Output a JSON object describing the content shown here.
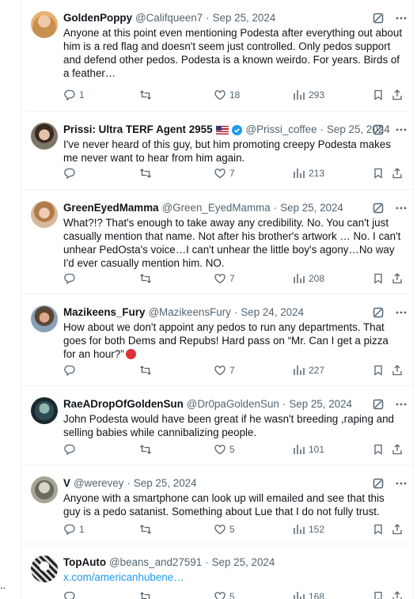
{
  "edge_text": "..",
  "tweets": [
    {
      "display_name": "GoldenPoppy",
      "handle": "@Califqueen7",
      "sep": "·",
      "date": "Sep 25, 2024",
      "flag": false,
      "verified": false,
      "text": "Anyone at this point even mentioning Podesta after everything out about him is a red flag and doesn't seem just controlled. Only pedos support and defend other pedos. Podesta is a known weirdo. For years. Birds of a feather…",
      "replies": "1",
      "retweets": "",
      "likes": "18",
      "views": "293"
    },
    {
      "display_name": "Prissi: Ultra TERF Agent 2955",
      "handle": "@Prissi_coffee",
      "sep": "·",
      "date": "Sep 25, 2024",
      "flag": true,
      "verified": true,
      "text": "I've never heard of this guy, but him promoting creepy Podesta makes me never want to hear from him again.",
      "replies": "",
      "retweets": "",
      "likes": "7",
      "views": "213"
    },
    {
      "display_name": "GreenEyedMamma",
      "handle": "@Green_EyedMamma",
      "sep": "·",
      "date": "Sep 25, 2024",
      "flag": false,
      "verified": false,
      "text": "What?!? That's enough to take away any credibility. No. You can't just casually mention that name. Not after his brother's artwork … No. I can't unhear PedOsta's voice…I can't unhear the little boy's agony…No way I'd ever casually mention him. NO.",
      "replies": "",
      "retweets": "",
      "likes": "7",
      "views": "208"
    },
    {
      "display_name": "Mazikeens_Fury",
      "handle": "@MazikeensFury",
      "sep": "·",
      "date": "Sep 24, 2024",
      "flag": false,
      "verified": false,
      "text": "How about we don't appoint any pedos to run any departments. That goes for both Dems and Repubs!  Hard pass on “Mr. Can I get a pizza for an hour?”",
      "emoji": "angry-face",
      "replies": "",
      "retweets": "",
      "likes": "7",
      "views": "227"
    },
    {
      "display_name": "RaeADropOfGoldenSun",
      "handle": "@Dr0paGoldenSun",
      "sep": "·",
      "date": "Sep 25, 2024",
      "flag": false,
      "verified": false,
      "text": "John Podesta would have been great if he wasn't breeding ,raping and selling babies while cannibalizing people.",
      "replies": "",
      "retweets": "",
      "likes": "5",
      "views": "101"
    },
    {
      "display_name": "V",
      "handle": "@werevey",
      "sep": "·",
      "date": "Sep 25, 2024",
      "flag": false,
      "verified": false,
      "text": "Anyone with a smartphone can look up will emailed and see that this guy is a pedo satanist. Something about Lue that I do not fully trust.",
      "replies": "1",
      "retweets": "",
      "likes": "5",
      "views": "152"
    },
    {
      "display_name": "TopAuto",
      "handle": "@beans_and27591",
      "sep": "·",
      "date": "Sep 25, 2024",
      "flag": false,
      "verified": false,
      "link": "x.com/americanhubene…",
      "replies": "",
      "retweets": "",
      "likes": "5",
      "views": "168"
    }
  ],
  "colors": {
    "text": "#0f1419",
    "muted": "#536471",
    "link": "#1d9bf0",
    "verified": "#1d9bf0",
    "divider": "#eff3f4"
  },
  "icons": [
    "reply-icon",
    "retweet-icon",
    "like-icon",
    "views-icon",
    "bookmark-icon",
    "share-icon",
    "grok-icon",
    "more-icon",
    "verified-badge-icon",
    "us-flag-icon"
  ]
}
